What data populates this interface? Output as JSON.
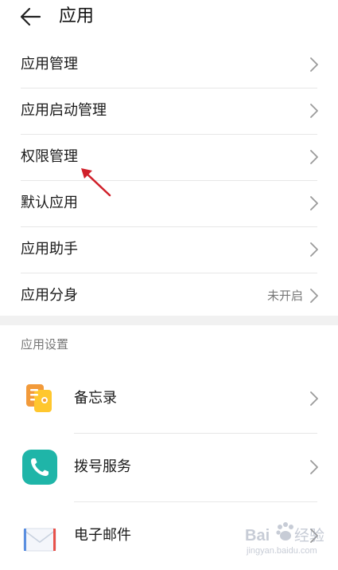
{
  "header": {
    "title": "应用"
  },
  "menu": [
    {
      "label": "应用管理",
      "value": ""
    },
    {
      "label": "应用启动管理",
      "value": ""
    },
    {
      "label": "权限管理",
      "value": ""
    },
    {
      "label": "默认应用",
      "value": ""
    },
    {
      "label": "应用助手",
      "value": ""
    },
    {
      "label": "应用分身",
      "value": "未开启"
    }
  ],
  "section": {
    "title": "应用设置"
  },
  "apps": [
    {
      "label": "备忘录",
      "icon": "memo-icon",
      "color": "#f5a623"
    },
    {
      "label": "拨号服务",
      "icon": "phone-icon",
      "color": "#1fb5a8"
    },
    {
      "label": "电子邮件",
      "icon": "mail-icon",
      "color": "#4a90e2"
    }
  ],
  "annotation": {
    "color": "#d0202a"
  },
  "watermark": {
    "brand": "Baidu",
    "text": "经验",
    "url": "jingyan.baidu.com"
  }
}
